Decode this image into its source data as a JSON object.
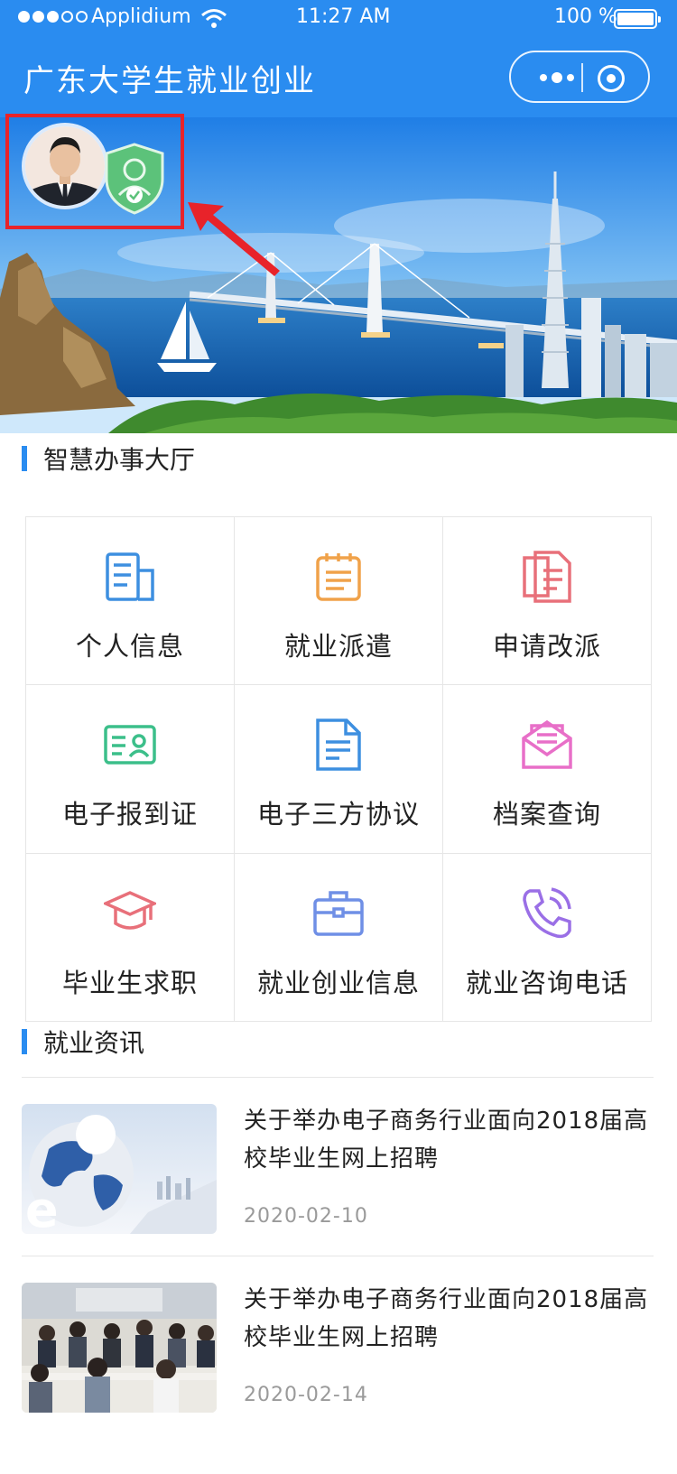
{
  "status_bar": {
    "carrier": "Applidium",
    "time": "11:27 AM",
    "battery": "100 %"
  },
  "nav": {
    "title": "广东大学生就业创业"
  },
  "sections": {
    "services_title": "智慧办事大厅",
    "news_title": "就业资讯"
  },
  "services": [
    {
      "label": "个人信息",
      "icon": "document-icon",
      "color": "#3d8fe0"
    },
    {
      "label": "就业派遣",
      "icon": "notepad-icon",
      "color": "#f0a24a"
    },
    {
      "label": "申请改派",
      "icon": "files-icon",
      "color": "#e8707a"
    },
    {
      "label": "电子报到证",
      "icon": "id-card-icon",
      "color": "#3cbf8a"
    },
    {
      "label": "电子三方协议",
      "icon": "contract-icon",
      "color": "#3d8fe0"
    },
    {
      "label": "档案查询",
      "icon": "envelope-icon",
      "color": "#e86fc8"
    },
    {
      "label": "毕业生求职",
      "icon": "graduation-cap-icon",
      "color": "#e8707a"
    },
    {
      "label": "就业创业信息",
      "icon": "briefcase-icon",
      "color": "#6f8fe6"
    },
    {
      "label": "就业咨询电话",
      "icon": "phone-icon",
      "color": "#9a6fe6"
    }
  ],
  "news": [
    {
      "title": "关于举办电子商务行业面向2018届高校毕业生网上招聘",
      "date": "2020-02-10",
      "thumb": "globe-thumbnail"
    },
    {
      "title": "关于举办电子商务行业面向2018届高校毕业生网上招聘",
      "date": "2020-02-14",
      "thumb": "meeting-photo-thumbnail"
    }
  ],
  "colors": {
    "primary": "#2a8cf0",
    "highlight_box": "#e8232a"
  }
}
